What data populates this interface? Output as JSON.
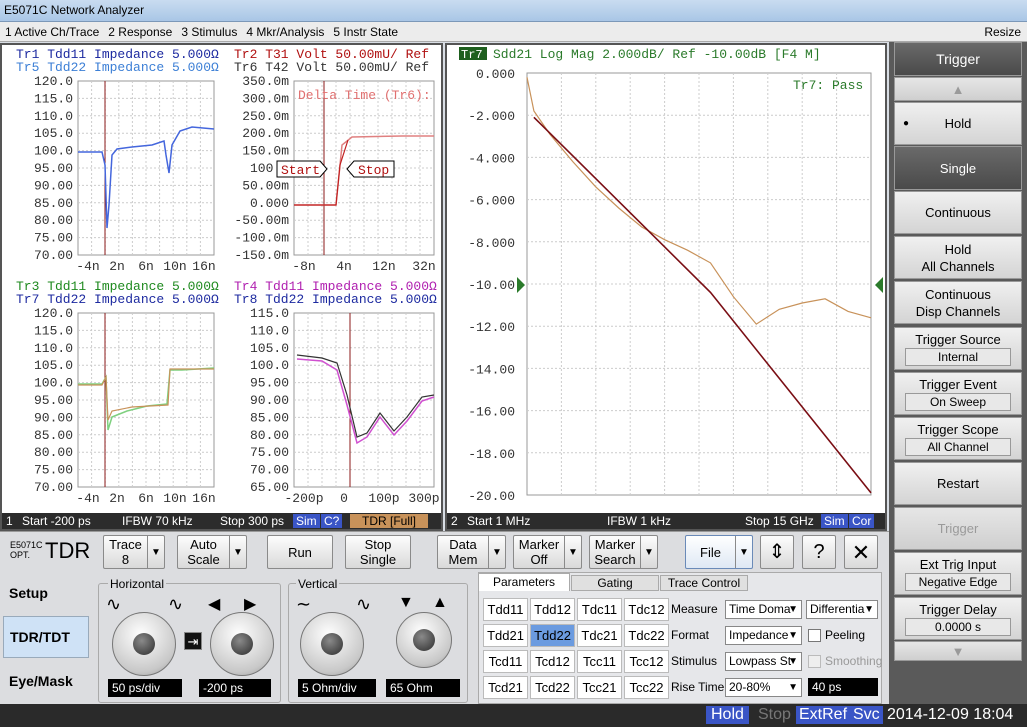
{
  "window": {
    "title": "E5071C Network Analyzer",
    "resize": "Resize"
  },
  "menu": [
    "1 Active Ch/Trace",
    "2 Response",
    "3 Stimulus",
    "4 Mkr/Analysis",
    "5 Instr State"
  ],
  "ch1": {
    "q1": {
      "head1": "Tr1 Tdd11 Impedance 5.000Ω",
      "head2": "Tr5 Tdd22 Impedance 5.000Ω",
      "yticks": [
        "120.0",
        "115.0",
        "110.0",
        "105.0",
        "100.0",
        "95.00",
        "90.00",
        "85.00",
        "80.00",
        "75.00",
        "70.00"
      ],
      "xticks": [
        "-4n",
        "2n",
        "6n",
        "10n",
        "16n"
      ]
    },
    "q2": {
      "head1": "Tr2 T31 Volt 50.00mU/ Ref",
      "head2": "Tr6 T42 Volt 50.00mU/ Ref",
      "yticks": [
        "350.0m",
        "300.0m",
        "250.0m",
        "200.0m",
        "150.0m",
        "100.0",
        "50.00m",
        "0.000",
        "-50.00m",
        "-100.0m",
        "-150.0m"
      ],
      "xticks": [
        "-8n",
        "4n",
        "12n",
        "32n"
      ],
      "delta": "Delta Time (Tr6):",
      "start": "Start",
      "stop": "Stop"
    },
    "q3": {
      "head1": "Tr3 Tdd11 Impedance 5.000Ω",
      "head2": "Tr7 Tdd22 Impedance 5.000Ω",
      "yticks": [
        "120.0",
        "115.0",
        "110.0",
        "105.0",
        "100.0",
        "95.00",
        "90.00",
        "85.00",
        "80.00",
        "75.00",
        "70.00"
      ],
      "xticks": [
        "-4n",
        "2n",
        "6n",
        "10n",
        "16n"
      ]
    },
    "q4": {
      "head1": "Tr4 Tdd11 Impedance 5.000Ω",
      "head2": "Tr8 Tdd22 Impedance 5.000Ω",
      "yticks": [
        "115.0",
        "110.0",
        "105.0",
        "100.0",
        "95.00",
        "90.00",
        "85.00",
        "80.00",
        "75.00",
        "70.00",
        "65.00"
      ],
      "xticks": [
        "-200p",
        "0",
        "100p",
        "300p"
      ]
    },
    "status": {
      "num": "1",
      "start": "Start -200 ps",
      "ifbw": "IFBW 70 kHz",
      "stop": "Stop 300 ps",
      "sim": "Sim",
      "c": "C?",
      "tdr": "TDR [Full]"
    }
  },
  "ch2": {
    "tag": "Tr7",
    "head": "Sdd21 Log Mag 2.000dB/ Ref -10.00dB [F4 M]",
    "pass": "Tr7: Pass",
    "status": {
      "num": "2",
      "start": "Start 1 MHz",
      "ifbw": "IFBW 1 kHz",
      "stop": "Stop 15 GHz",
      "sim": "Sim",
      "cor": "Cor"
    }
  },
  "chart_data": {
    "type": "line",
    "title": "Sdd21 Log Mag 2.000dB/ Ref -10.00dB [F4 M]",
    "xlabel": "",
    "ylabel": "",
    "xlim": [
      0.001,
      15
    ],
    "ylim": [
      -20,
      0
    ],
    "yticks": [
      "0.000",
      "-2.000",
      "-4.000",
      "-6.000",
      "-8.000",
      "-10.00",
      "-12.00",
      "-14.00",
      "-16.00",
      "-18.00",
      "-20.00"
    ],
    "grid": true,
    "series": [
      {
        "color": "#c8925a",
        "x": [
          0.001,
          0.3,
          1,
          2,
          3,
          4,
          5,
          6,
          7,
          8,
          9,
          10,
          11,
          12,
          13,
          14,
          15
        ],
        "y": [
          -0.2,
          -1.8,
          -2.9,
          -4.2,
          -5.4,
          -6.4,
          -7.3,
          -7.9,
          -8.4,
          -9.0,
          -10.6,
          -11.9,
          -11.2,
          -10.9,
          -10.7,
          -11.3,
          -11.6
        ]
      },
      {
        "color": "#7a0e14",
        "x": [
          0.3,
          8,
          15
        ],
        "y": [
          -2.1,
          -10.4,
          -19.9
        ]
      }
    ]
  },
  "control": {
    "logo1": "E5071C",
    "logo2": "OPT.",
    "logo3": "TDR",
    "buttons": {
      "trace": "Trace",
      "trace_val": "8",
      "autoscale1": "Auto",
      "autoscale2": "Scale",
      "run": "Run",
      "stop1": "Stop",
      "stop2": "Single",
      "datamem1": "Data",
      "datamem2": "Mem",
      "marker1": "Marker",
      "marker2": "Off",
      "msearch1": "Marker",
      "msearch2": "Search",
      "file": "File",
      "help": "?"
    },
    "tabs": [
      "Setup",
      "TDR/TDT",
      "Eye/Mask"
    ],
    "horizontal": {
      "label": "Horizontal",
      "scale": "50 ps/div",
      "pos": "-200 ps"
    },
    "vertical": {
      "label": "Vertical",
      "scale": "5 Ohm/div",
      "pos": "65 Ohm"
    },
    "ptabs": [
      "Parameters",
      "Gating",
      "Trace Control"
    ],
    "grid": [
      [
        "Tdd11",
        "Tdd12",
        "Tdc11",
        "Tdc12"
      ],
      [
        "Tdd21",
        "Tdd22",
        "Tdc21",
        "Tdc22"
      ],
      [
        "Tcd11",
        "Tcd12",
        "Tcc11",
        "Tcc12"
      ],
      [
        "Tcd21",
        "Tcd22",
        "Tcc21",
        "Tcc22"
      ]
    ],
    "measure": {
      "label": "Measure",
      "value": "Time Doma",
      "value2": "Differentia"
    },
    "format": {
      "label": "Format",
      "value": "Impedance",
      "peeling": "Peeling"
    },
    "stimulus": {
      "label": "Stimulus",
      "value": "Lowpass St",
      "smoothing": "Smoothing"
    },
    "risetime": {
      "label": "Rise Time",
      "value": "20-80%",
      "value2": "40 ps"
    }
  },
  "softkeys": {
    "title": "Trigger",
    "hold": "Hold",
    "single": "Single",
    "continuous": "Continuous",
    "holdall1": "Hold",
    "holdall2": "All Channels",
    "contdisp1": "Continuous",
    "contdisp2": "Disp Channels",
    "source": "Trigger Source",
    "source_val": "Internal",
    "event": "Trigger Event",
    "event_val": "On Sweep",
    "scope": "Trigger Scope",
    "scope_val": "All Channel",
    "restart": "Restart",
    "trigger": "Trigger",
    "ext": "Ext Trig Input",
    "ext_val": "Negative Edge",
    "delay": "Trigger Delay",
    "delay_val": "0.0000 s"
  },
  "statusbar": {
    "hold": "Hold",
    "stop": "Stop",
    "extref": "ExtRef",
    "svc": "Svc",
    "datetime": "2014-12-09 18:04"
  }
}
